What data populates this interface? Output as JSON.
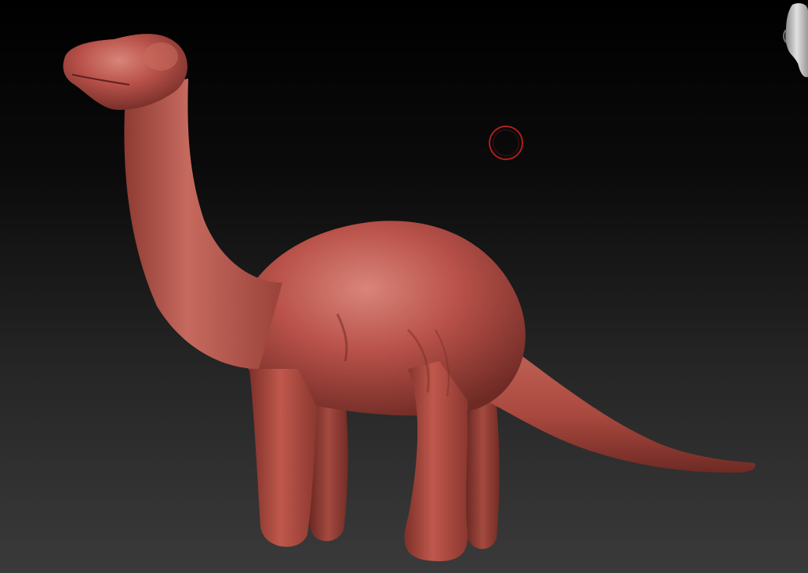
{
  "viewport": {
    "background_top": "#000000",
    "background_bottom": "#3a3a3a"
  },
  "model": {
    "subject": "dinosaur-sculpt",
    "material_color": "#b9524a",
    "highlight_color": "#d9857a",
    "shadow_color": "#6e2a24"
  },
  "brush_cursor": {
    "color": "#b01e1e"
  },
  "navigation_widget": {
    "icon": "head-icon"
  }
}
